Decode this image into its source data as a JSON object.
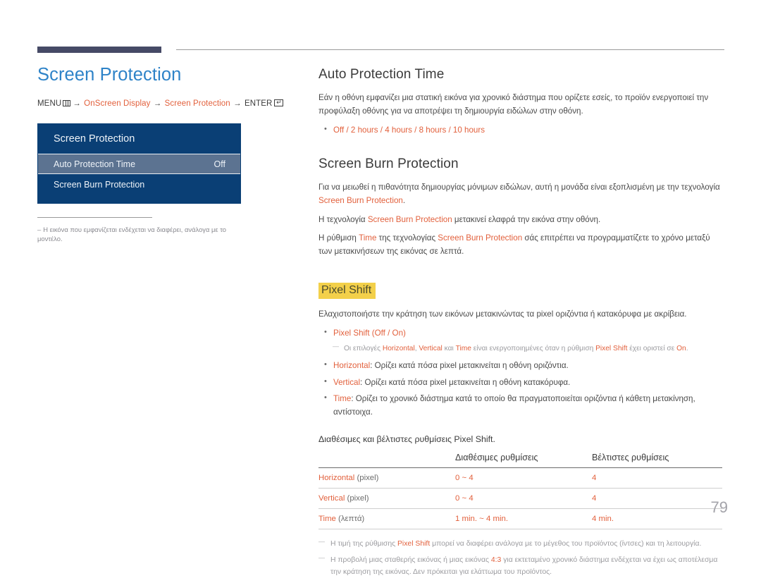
{
  "page": {
    "number": "79"
  },
  "left": {
    "title": "Screen Protection",
    "breadcrumb": {
      "menu_label": "MENU",
      "menu_icon": "menu-grid-icon",
      "arrow": "→",
      "item1": "OnScreen Display",
      "item2": "Screen Protection",
      "enter_label": "ENTER",
      "enter_icon": "enter-key-icon"
    },
    "osd": {
      "header": "Screen Protection",
      "rows": [
        {
          "label": "Auto Protection Time",
          "value": "Off",
          "selected": true
        },
        {
          "label": "Screen Burn Protection",
          "value": "",
          "selected": false
        }
      ]
    },
    "note": {
      "dash": "–",
      "text": "Η εικόνα που εμφανίζεται ενδέχεται να διαφέρει, ανάλογα με το μοντέλο."
    }
  },
  "right": {
    "auto_protection": {
      "heading": "Auto Protection Time",
      "paragraph": "Εάν η οθόνη εμφανίζει μια στατική εικόνα για χρονικό διάστημα που ορίζετε εσείς, το προϊόν ενεργοποιεί την προφύλαξη οθόνης για να αποτρέψει τη δημιουργία ειδώλων στην οθόνη.",
      "options": "Off / 2 hours / 4 hours / 8 hours / 10 hours"
    },
    "burn_protection": {
      "heading": "Screen Burn Protection",
      "p1_a": "Για να μειωθεί η πιθανότητα δημιουργίας μόνιμων ειδώλων, αυτή η μονάδα είναι εξοπλισμένη με την τεχνολογία ",
      "p1_term": "Screen Burn Protection",
      "p1_b": ".",
      "p2_a": "Η τεχνολογία ",
      "p2_term": "Screen Burn Protection",
      "p2_b": " μετακινεί ελαφρά την εικόνα στην οθόνη.",
      "p3_a": "Η ρύθμιση ",
      "p3_term1": "Time",
      "p3_b": " της τεχνολογίας ",
      "p3_term2": "Screen Burn Protection",
      "p3_c": " σάς επιτρέπει να προγραμματίζετε το χρόνο μεταξύ των μετακινήσεων της εικόνας σε λεπτά."
    },
    "pixel_shift": {
      "heading": "Pixel Shift",
      "intro": "Ελαχιστοποιήστε την κράτηση των εικόνων μετακινώντας τα pixel οριζόντια ή κατακόρυφα με ακρίβεια.",
      "b1_term": "Pixel Shift",
      "b1_rest": " (Off / On)",
      "sub_a": "Οι επιλογές ",
      "sub_t1": "Horizontal",
      "sub_b": ", ",
      "sub_t2": "Vertical",
      "sub_c": " και ",
      "sub_t3": "Time",
      "sub_d": " είναι ενεργοποιημένες όταν η ρύθμιση ",
      "sub_t4": "Pixel Shift",
      "sub_e": " έχει οριστεί σε ",
      "sub_t5": "On",
      "sub_f": ".",
      "b2_term": "Horizontal",
      "b2_rest": ": Ορίζει κατά πόσα pixel μετακινείται η οθόνη οριζόντια.",
      "b3_term": "Vertical",
      "b3_rest": ": Ορίζει κατά πόσα pixel μετακινείται η οθόνη κατακόρυφα.",
      "b4_term": "Time",
      "b4_rest": ": Ορίζει το χρονικό διάστημα κατά το οποίο θα πραγματοποιείται οριζόντια ή κάθετη μετακίνηση, αντίστοιχα."
    },
    "table": {
      "caption": "Διαθέσιμες και βέλτιστες ρυθμίσεις Pixel Shift.",
      "headers": [
        "",
        "Διαθέσιμες ρυθμίσεις",
        "Βέλτιστες ρυθμίσεις"
      ],
      "rows": [
        {
          "name": "Horizontal",
          "unit": " (pixel)",
          "available": "0 ~ 4",
          "optimum": "4"
        },
        {
          "name": "Vertical",
          "unit": " (pixel)",
          "available": "0 ~ 4",
          "optimum": "4"
        },
        {
          "name": "Time",
          "unit": " (λεπτά)",
          "available": "1 min. ~ 4 min.",
          "optimum": "4 min."
        }
      ]
    },
    "footnotes": {
      "f1_a": "Η τιμή της ρύθμισης ",
      "f1_term": "Pixel Shift",
      "f1_b": " μπορεί να διαφέρει ανάλογα με το μέγεθος του προϊόντος (ίντσες) και τη λειτουργία.",
      "f2_a": "Η προβολή μιας σταθερής εικόνας ή μιας εικόνας ",
      "f2_term": "4:3",
      "f2_b": " για εκτεταμένο χρονικό διάστημα ενδέχεται να έχει ως αποτέλεσμα την κράτηση της εικόνας. Δεν πρόκειται για ελάττωμα του προϊόντος."
    }
  },
  "colors": {
    "title_blue": "#2e83c8",
    "accent_orange": "#e2603c",
    "osd_blue": "#0a3f75",
    "osd_highlight": "#5c7391",
    "highlight_yellow": "#f3d04a",
    "rule_dark": "#464a66"
  }
}
